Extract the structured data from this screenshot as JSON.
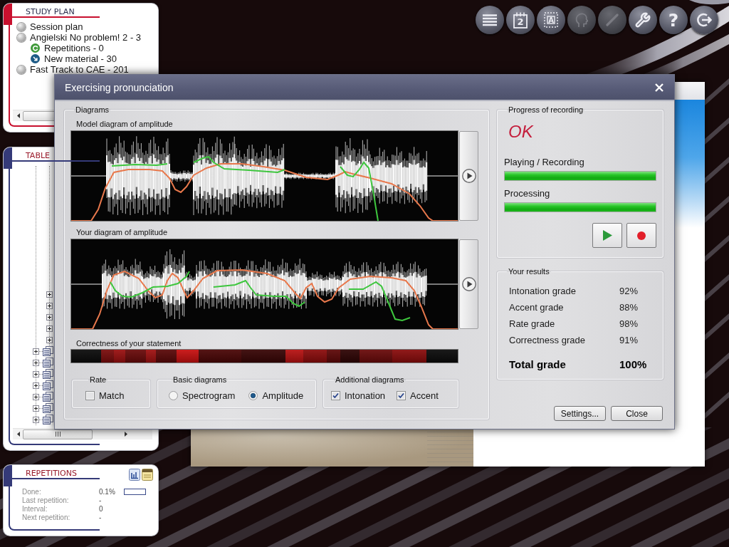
{
  "toolbar": [
    {
      "kind": "menu",
      "disabled": false
    },
    {
      "kind": "calendar",
      "glyph": "2",
      "disabled": false
    },
    {
      "kind": "card",
      "glyph": "A",
      "disabled": false
    },
    {
      "kind": "head",
      "disabled": true
    },
    {
      "kind": "pencil",
      "disabled": true
    },
    {
      "kind": "wrench",
      "disabled": false
    },
    {
      "kind": "help",
      "glyph": "?",
      "disabled": false
    },
    {
      "kind": "exit",
      "disabled": false
    }
  ],
  "study_plan": {
    "title": "STUDY PLAN",
    "items": [
      {
        "kind": "bullet",
        "label": "Session plan"
      },
      {
        "kind": "bullet",
        "label": "Angielski No problem! 2 - 3",
        "children": [
          {
            "kind": "repetitions",
            "label": "Repetitions - 0"
          },
          {
            "kind": "new_material",
            "label": "New material - 30"
          }
        ]
      },
      {
        "kind": "bullet",
        "label": "Fast Track to CAE - 201"
      }
    ]
  },
  "table_of_contents": {
    "title": "TABLE",
    "items": [
      {
        "kind": "group",
        "children": [
          {
            "kind": "node",
            "expanded": false
          },
          {
            "kind": "node",
            "expanded": false
          },
          {
            "kind": "node",
            "expanded": false
          },
          {
            "kind": "node",
            "expanded": false
          },
          {
            "kind": "node",
            "expanded": false
          }
        ]
      },
      {
        "kind": "document",
        "expanded": false
      },
      {
        "kind": "document",
        "expanded": false
      },
      {
        "kind": "document",
        "expanded": false
      },
      {
        "kind": "document",
        "expanded": false
      },
      {
        "kind": "document",
        "expanded": false
      },
      {
        "kind": "document",
        "expanded": false
      },
      {
        "kind": "document",
        "expanded": false
      }
    ]
  },
  "repetitions": {
    "title": "REPETITIONS",
    "rows": [
      {
        "label": "Done:",
        "value": "0.1%",
        "level": 0.001
      },
      {
        "label": "Last repetition:",
        "value": "-"
      },
      {
        "label": "Interval:",
        "value": "0"
      },
      {
        "label": "Next repetition:",
        "value": "-"
      }
    ]
  },
  "dialog": {
    "title": "Exercising pronunciation",
    "diagrams": {
      "title": "Diagrams",
      "panels": [
        {
          "label": "Model diagram of amplitude"
        },
        {
          "label": "Your diagram of amplitude"
        }
      ],
      "correctness_label": "Correctness of your statement",
      "rate": {
        "title": "Rate",
        "options": [
          {
            "label": "Match",
            "checked": false
          }
        ]
      },
      "basic_diagrams": {
        "title": "Basic diagrams",
        "options": [
          {
            "label": "Spectrogram",
            "selected": false
          },
          {
            "label": "Amplitude",
            "selected": true
          }
        ]
      },
      "additional_diagrams": {
        "title": "Additional diagrams",
        "options": [
          {
            "label": "Intonation",
            "checked": true
          },
          {
            "label": "Accent",
            "checked": true
          }
        ]
      }
    },
    "progress": {
      "title": "Progress of recording",
      "status": "OK",
      "bars": [
        {
          "label": "Playing / Recording",
          "level": 1
        },
        {
          "label": "Processing",
          "level": 1
        }
      ]
    },
    "results": {
      "title": "Your results",
      "rows": [
        {
          "kind": "grade",
          "label": "Intonation grade",
          "value": "92%"
        },
        {
          "kind": "grade",
          "label": "Accent grade",
          "value": "88%"
        },
        {
          "kind": "grade",
          "label": "Rate grade",
          "value": "98%"
        },
        {
          "kind": "grade",
          "label": "Correctness grade",
          "value": "91%"
        },
        {
          "kind": "total",
          "label": "Total grade",
          "value": "100%"
        }
      ]
    },
    "buttons": [
      {
        "label": "Settings..."
      },
      {
        "label": "Close"
      }
    ]
  }
}
